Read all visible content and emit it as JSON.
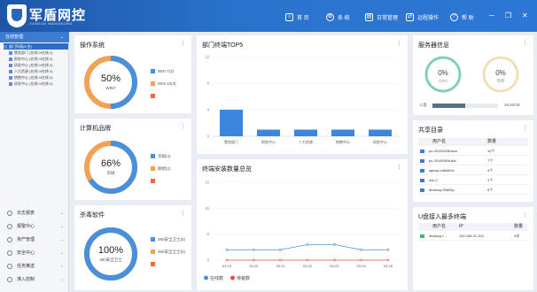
{
  "app": {
    "brand": "军盾网控",
    "brand_sub": "JUNDUN WANGKONG",
    "nav": [
      {
        "label": "首 页",
        "icon": "home-icon",
        "glyph": "⌂"
      },
      {
        "label": "系 统",
        "icon": "system-icon",
        "glyph": "⚙"
      },
      {
        "label": "日常管理",
        "icon": "daily-management-icon",
        "glyph": "▤"
      },
      {
        "label": "远程操作",
        "icon": "remote-operation-icon",
        "glyph": "⇄"
      },
      {
        "label": "帮 助",
        "icon": "help-icon",
        "glyph": "?"
      }
    ]
  },
  "sidebar": {
    "header": "在线管理",
    "tree": [
      "部门列表(6 台)",
      "策划部门 (在线 0/在线 0)",
      "财务中心 (在线 0/在线 0)",
      "研发中心 (在线 0/在线 0)",
      "人力资源 (在线 0/在线 0)",
      "销售中心 (在线 0/在线 0)",
      "研发中心 (在线 0/在线 0)"
    ],
    "menu": [
      {
        "label": "日志报表",
        "icon": "log-report-icon"
      },
      {
        "label": "报警中心",
        "icon": "alarm-center-icon"
      },
      {
        "label": "资产管理",
        "icon": "asset-management-icon"
      },
      {
        "label": "安全中心",
        "icon": "security-center-icon"
      },
      {
        "label": "任务推送",
        "icon": "task-push-icon"
      },
      {
        "label": "准入控制",
        "icon": "access-control-icon"
      }
    ]
  },
  "os_card": {
    "title": "操作系统",
    "center_value": "50%",
    "center_label": "WIN7",
    "fraction": 0.5,
    "colors": [
      "#4a8fdc",
      "#f2a155"
    ],
    "legend": [
      {
        "label": "WIN 7(3)",
        "color": "#4a8fdc"
      },
      {
        "label": "WIN 10(3)",
        "color": "#f2a155"
      },
      {
        "label": "",
        "color": "#f06a3c"
      }
    ]
  },
  "brand_card": {
    "title": "计算机品牌",
    "center_value": "66%",
    "center_label": "华硕",
    "fraction": 0.66,
    "colors": [
      "#4a8fdc",
      "#f2a155"
    ],
    "legend": [
      {
        "label": "华硕(4)",
        "color": "#4a8fdc"
      },
      {
        "label": "联想(2)",
        "color": "#f2a155"
      },
      {
        "label": "",
        "color": "#f06a3c"
      }
    ]
  },
  "av_card": {
    "title": "杀毒软件",
    "center_value": "100%",
    "center_label": "360安全卫士",
    "fraction": 1.0,
    "colors": [
      "#4a8fdc",
      "#f2a155"
    ],
    "legend": [
      {
        "label": "360安全卫士(6)",
        "color": "#4a8fdc"
      },
      {
        "label": "360安全卫士(0)",
        "color": "#f2a155"
      },
      {
        "label": "",
        "color": "#f06a3c"
      }
    ]
  },
  "dept_card": {
    "title": "部门终端TOP5"
  },
  "install_card": {
    "title": "终端安装数量总览"
  },
  "server_card": {
    "title": "服务器信息",
    "cpu_value": "0%",
    "cpu_label": "CPU",
    "mem_value": "0%",
    "mem_label": "内存",
    "disk_label": "C盘",
    "disk_value": "39,50GB",
    "disk_fraction": 0.5
  },
  "share_card": {
    "title": "共享目录",
    "columns": [
      "用户名",
      "数量"
    ],
    "rows": [
      {
        "user": "pc-20190226hsnu",
        "count": "10个"
      },
      {
        "user": "pc-20190304nkxi",
        "count": "7个"
      },
      {
        "user": "laptop-hd6082xi",
        "count": "4个"
      },
      {
        "user": "win-2",
        "count": "1个"
      },
      {
        "user": "desktop-f3fa53p",
        "count": "5个"
      }
    ]
  },
  "usb_card": {
    "title": "U盘接入最多终端",
    "columns": [
      "用户名",
      "IP",
      "数量"
    ],
    "rows": [
      {
        "user": "desktop-f...",
        "ip": "192.168.21.203",
        "count": "0次"
      }
    ]
  },
  "chart_data": [
    {
      "type": "bar",
      "title": "部门终端TOP5",
      "categories": [
        "策划部门",
        "财务中心",
        "人力资源",
        "销售中心",
        "研发中心"
      ],
      "values": [
        4,
        1,
        1,
        1,
        1
      ],
      "ylim": [
        0,
        12
      ],
      "yticks": [
        0,
        4,
        8,
        12
      ],
      "color": "#3d86dd"
    },
    {
      "type": "line",
      "title": "终端安装数量总览",
      "x": [
        "03.19",
        "03.20",
        "03.21",
        "03.22",
        "03.23",
        "03.24",
        "03.25"
      ],
      "ylim": [
        0,
        15
      ],
      "yticks": [
        0,
        5,
        10,
        15
      ],
      "series": [
        {
          "name": "在线数",
          "color": "#4a8fdc",
          "values": [
            2,
            2,
            2,
            3,
            3,
            2,
            2
          ]
        },
        {
          "name": "待装数",
          "color": "#e8503a",
          "values": [
            0,
            0,
            0,
            0,
            0,
            0,
            0
          ]
        }
      ],
      "legend": "bottom-left"
    }
  ]
}
